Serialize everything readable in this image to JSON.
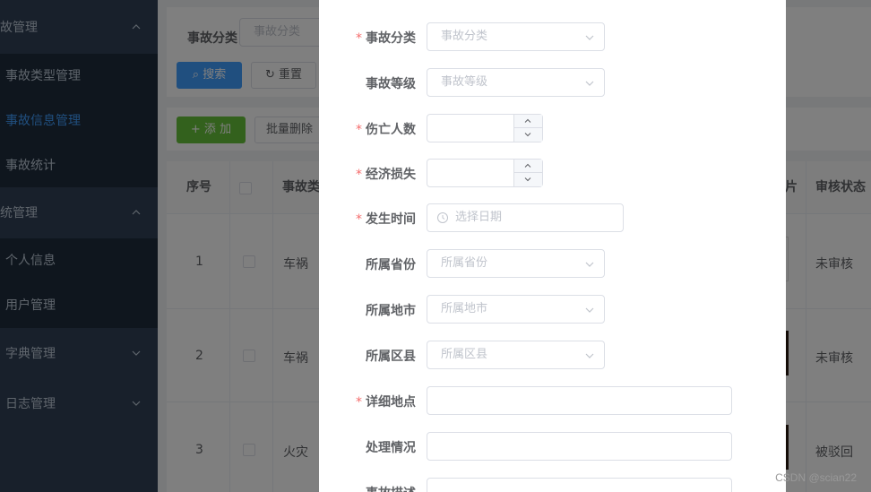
{
  "sidebar": {
    "groups": [
      {
        "label": "故管理",
        "expanded": true
      },
      {
        "label": "统管理",
        "expanded": true
      }
    ],
    "accident_items": [
      {
        "label": "事故类型管理",
        "active": false
      },
      {
        "label": "事故信息管理",
        "active": true
      },
      {
        "label": "事故统计",
        "active": false
      }
    ],
    "system_items": [
      {
        "label": "个人信息"
      },
      {
        "label": "用户管理"
      }
    ],
    "collapsed_groups": [
      {
        "label": "字典管理"
      },
      {
        "label": "日志管理"
      }
    ]
  },
  "search": {
    "label": "事故分类",
    "placeholder": "事故分类",
    "search_button": "搜索",
    "reset_button": "重置"
  },
  "toolbar": {
    "add_button": "+ 添 加",
    "batch_delete_button": "批量删除"
  },
  "table": {
    "headers": {
      "index": "序号",
      "category": "事故类",
      "image": "片",
      "status": "审核状态"
    },
    "rows": [
      {
        "index": "1",
        "category": "车祸",
        "status": "未审核"
      },
      {
        "index": "2",
        "category": "车祸",
        "status": "未审核"
      },
      {
        "index": "3",
        "category": "火灾",
        "status": "被驳回"
      }
    ]
  },
  "dialog": {
    "fields": {
      "category": {
        "label": "事故分类",
        "required": true,
        "placeholder": "事故分类"
      },
      "level": {
        "label": "事故等级",
        "required": false,
        "placeholder": "事故等级"
      },
      "casualties": {
        "label": "伤亡人数",
        "required": true,
        "value": ""
      },
      "loss": {
        "label": "经济损失",
        "required": true,
        "value": ""
      },
      "time": {
        "label": "发生时间",
        "required": true,
        "placeholder": "选择日期"
      },
      "province": {
        "label": "所属省份",
        "required": false,
        "placeholder": "所属省份"
      },
      "city": {
        "label": "所属地市",
        "required": false,
        "placeholder": "所属地市"
      },
      "county": {
        "label": "所属区县",
        "required": false,
        "placeholder": "所属区县"
      },
      "address": {
        "label": "详细地点",
        "required": true,
        "value": ""
      },
      "handling": {
        "label": "处理情况",
        "required": false,
        "value": ""
      },
      "description": {
        "label": "事故描述",
        "required": false,
        "value": ""
      }
    },
    "required_mark": "*"
  },
  "watermark": "CSDN @scian22",
  "colors": {
    "sidebar_bg": "#304156",
    "submenu_bg": "#1f2d3d",
    "menu_text": "#bfcbd9",
    "active": "#409eff",
    "success": "#67c23a",
    "required": "#f56c6c"
  }
}
